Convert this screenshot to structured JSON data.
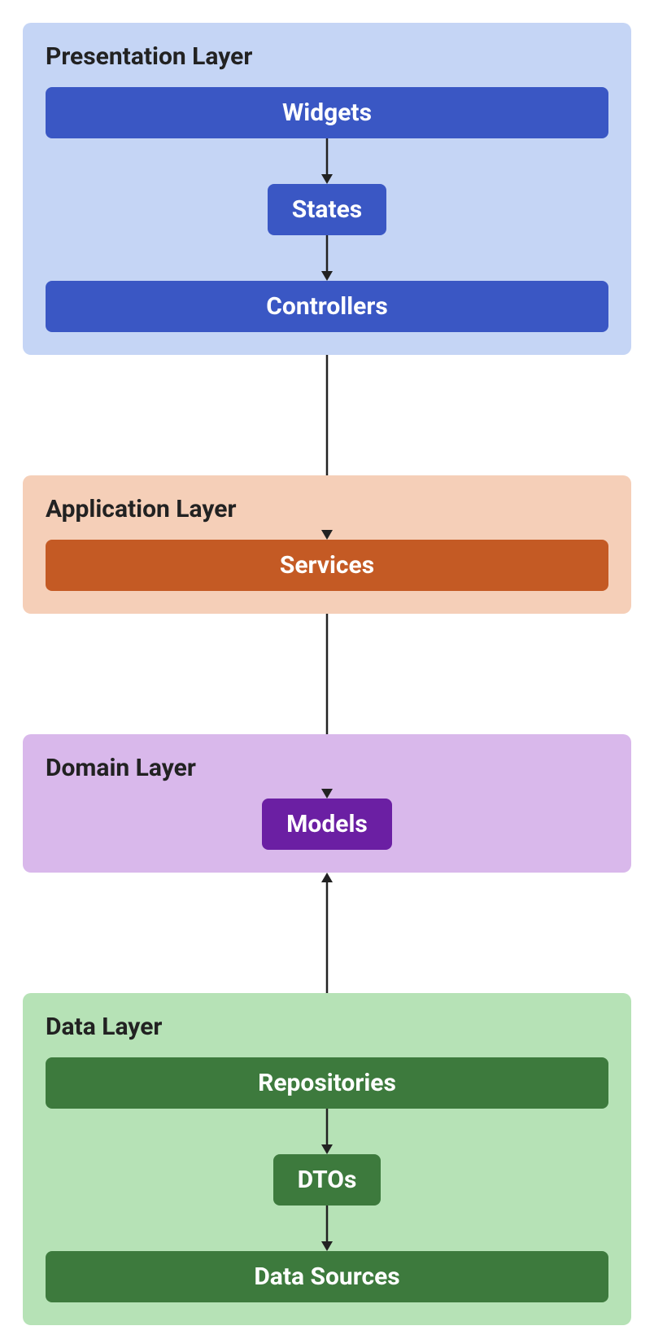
{
  "layers": {
    "presentation": {
      "title": "Presentation Layer",
      "widgets": "Widgets",
      "states": "States",
      "controllers": "Controllers"
    },
    "application": {
      "title": "Application Layer",
      "services": "Services"
    },
    "domain": {
      "title": "Domain Layer",
      "models": "Models"
    },
    "data": {
      "title": "Data Layer",
      "repositories": "Repositories",
      "dtos": "DTOs",
      "datasources": "Data Sources"
    }
  },
  "colors": {
    "presentation_bg": "#c5d5f5",
    "application_bg": "#f5cfb8",
    "domain_bg": "#d9b8eb",
    "data_bg": "#b6e2b6",
    "blue_box": "#3a57c4",
    "orange_box": "#c45a24",
    "purple_box": "#6b1fa3",
    "green_box": "#3d7a3d"
  }
}
